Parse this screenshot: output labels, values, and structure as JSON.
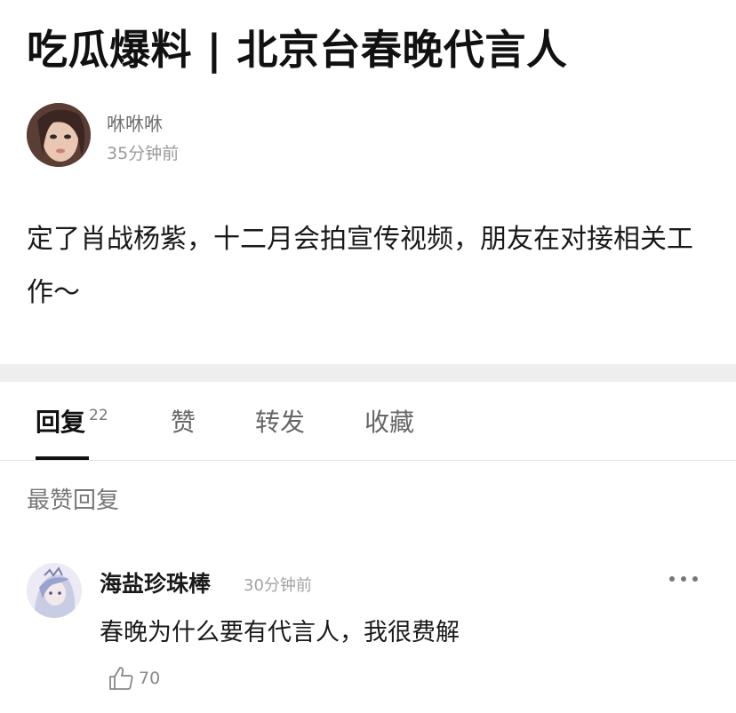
{
  "post": {
    "title": "吃瓜爆料 | 北京台春晚代言人",
    "author": {
      "name": "咻咻咻",
      "time": "35分钟前",
      "avatar": "avatar"
    },
    "content": "定了肖战杨紫，十二月会拍宣传视频，朋友在对接相关工作～"
  },
  "tabs": [
    {
      "label": "回复",
      "count": "22",
      "active": true
    },
    {
      "label": "赞",
      "active": false
    },
    {
      "label": "转发",
      "active": false
    },
    {
      "label": "收藏",
      "active": false
    }
  ],
  "comments_section": {
    "label": "最赞回复",
    "items": [
      {
        "name": "海盐珍珠棒",
        "time": "30分钟前",
        "text": "春晚为什么要有代言人，我很费解",
        "likes": "70",
        "avatar": "avatar",
        "more_icon": "more-icon",
        "like_icon": "thumbs-up-icon"
      }
    ]
  },
  "colors": {
    "divider_band": "#eeeeee",
    "active_tab": "#111111",
    "secondary_text": "#777777"
  }
}
